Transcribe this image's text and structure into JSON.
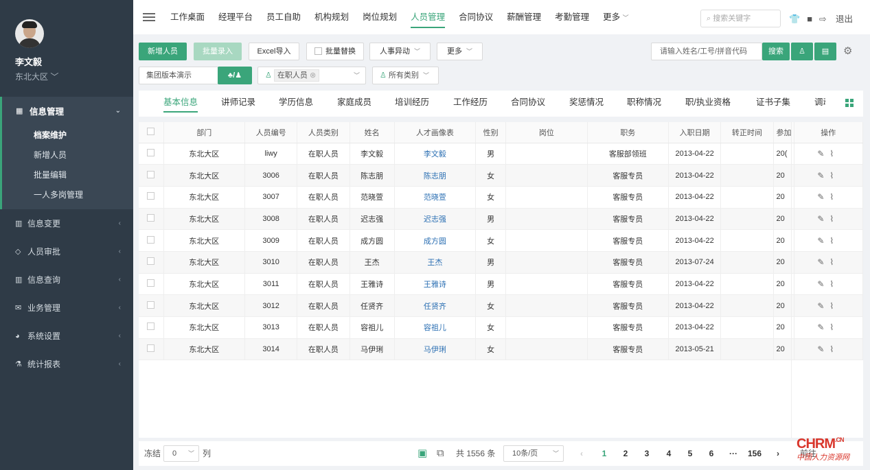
{
  "user": {
    "name": "李文毅",
    "region": "东北大区"
  },
  "sidebar": {
    "group": {
      "label": "信息管理",
      "items": [
        "档案维护",
        "新增人员",
        "批量编辑",
        "一人多岗管理"
      ]
    },
    "items": [
      {
        "label": "信息变更",
        "icon": "bar-chart-icon"
      },
      {
        "label": "人员审批",
        "icon": "diamond-icon"
      },
      {
        "label": "信息查询",
        "icon": "bar-chart-icon"
      },
      {
        "label": "业务管理",
        "icon": "mail-icon"
      },
      {
        "label": "系统设置",
        "icon": "pie-chart-icon"
      },
      {
        "label": "统计报表",
        "icon": "flask-icon"
      }
    ]
  },
  "topnav": {
    "tabs": [
      "工作桌面",
      "经理平台",
      "员工自助",
      "机构规划",
      "岗位规划",
      "人员管理",
      "合同协议",
      "薪酬管理",
      "考勤管理",
      "更多"
    ],
    "search_placeholder": "搜索关键字",
    "logout": "退出"
  },
  "toolbar": {
    "add": "新增人员",
    "batch_entry": "批量录入",
    "excel": "Excel导入",
    "batch_replace": "批量替换",
    "change": "人事异动",
    "more": "更多",
    "search_placeholder": "请输入姓名/工号/拼音代码",
    "search": "搜索"
  },
  "filters": {
    "org": "集团版本演示",
    "status": "在职人员",
    "category": "所有类别"
  },
  "tabs": [
    "基本信息",
    "讲师记录",
    "学历信息",
    "家庭成员",
    "培训经历",
    "工作经历",
    "合同协议",
    "奖惩情况",
    "职称情况",
    "职/执业资格",
    "证书子集",
    "调动"
  ],
  "table": {
    "headers": [
      "部门",
      "人员编号",
      "人员类别",
      "姓名",
      "人才画像表",
      "性别",
      "岗位",
      "职务",
      "入职日期",
      "转正时间",
      "参加",
      "操作"
    ],
    "rows": [
      [
        "东北大区",
        "liwy",
        "在职人员",
        "李文毅",
        "李文毅",
        "男",
        "",
        "客服部领班",
        "2013-04-22",
        "",
        "20("
      ],
      [
        "东北大区",
        "3006",
        "在职人员",
        "陈志朋",
        "陈志朋",
        "女",
        "",
        "客服专员",
        "2013-04-22",
        "",
        "20"
      ],
      [
        "东北大区",
        "3007",
        "在职人员",
        "范晓萱",
        "范晓萱",
        "女",
        "",
        "客服专员",
        "2013-04-22",
        "",
        "20"
      ],
      [
        "东北大区",
        "3008",
        "在职人员",
        "迟志强",
        "迟志强",
        "男",
        "",
        "客服专员",
        "2013-04-22",
        "",
        "20"
      ],
      [
        "东北大区",
        "3009",
        "在职人员",
        "成方圆",
        "成方圆",
        "女",
        "",
        "客服专员",
        "2013-04-22",
        "",
        "20"
      ],
      [
        "东北大区",
        "3010",
        "在职人员",
        "王杰",
        "王杰",
        "男",
        "",
        "客服专员",
        "2013-07-24",
        "",
        "20"
      ],
      [
        "东北大区",
        "3011",
        "在职人员",
        "王雅诗",
        "王雅诗",
        "男",
        "",
        "客服专员",
        "2013-04-22",
        "",
        "20"
      ],
      [
        "东北大区",
        "3012",
        "在职人员",
        "任贤齐",
        "任贤齐",
        "女",
        "",
        "客服专员",
        "2013-04-22",
        "",
        "20"
      ],
      [
        "东北大区",
        "3013",
        "在职人员",
        "容祖儿",
        "容祖儿",
        "女",
        "",
        "客服专员",
        "2013-04-22",
        "",
        "20"
      ],
      [
        "东北大区",
        "3014",
        "在职人员",
        "马伊琍",
        "马伊琍",
        "女",
        "",
        "客服专员",
        "2013-05-21",
        "",
        "20"
      ]
    ]
  },
  "footer": {
    "freeze": "冻结",
    "freeze_value": "0",
    "col": "列",
    "total": "共 1556 条",
    "page_size": "10条/页",
    "pages": [
      "1",
      "2",
      "3",
      "4",
      "5",
      "6",
      "···",
      "156"
    ],
    "goto": "前往",
    "current_page": "1"
  },
  "watermark": {
    "brand": "CHRM",
    "domain": ".CN",
    "slogan": "中国人力资源网"
  },
  "colors": {
    "accent": "#3aa57a",
    "sidebar": "#2f3b47",
    "link": "#2b6fb3"
  }
}
